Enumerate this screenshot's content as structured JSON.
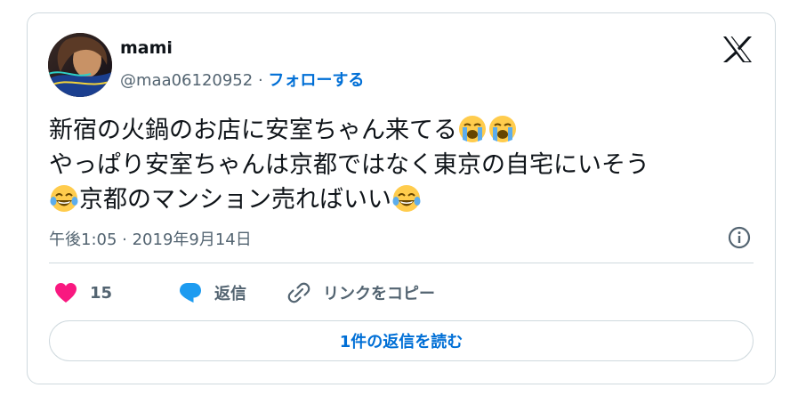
{
  "author": {
    "display_name": "mami",
    "handle": "@maa06120952",
    "separator": "·",
    "follow_label": "フォローする"
  },
  "icons": {
    "logo": "x-logo-icon",
    "avatar": "profile-photo",
    "crying_emoji": "loudly-crying-face-icon",
    "laughing_emoji": "face-with-tears-of-joy-icon",
    "info": "info-icon",
    "like": "heart-icon",
    "reply": "speech-bubble-icon",
    "copy_link": "link-icon"
  },
  "tweet": {
    "line1_text": "新宿の火鍋のお店に安室ちゃん来てる",
    "line2_text": "やっぱり安室ちゃんは京都ではなく東京の自宅にいそう",
    "line3_text": "京都のマンション売ればいい",
    "timestamp": "午後1:05 · 2019年9月14日"
  },
  "actions": {
    "like_count": "15",
    "reply_label": "返信",
    "copy_link_label": "リンクをコピー"
  },
  "read_replies_label": "1件の返信を読む",
  "colors": {
    "text_primary": "#0f1419",
    "text_secondary": "#536471",
    "link_blue": "#006fd6",
    "like_pink": "#f91880",
    "reply_blue": "#1d9bf0",
    "border": "#cfd9de"
  }
}
